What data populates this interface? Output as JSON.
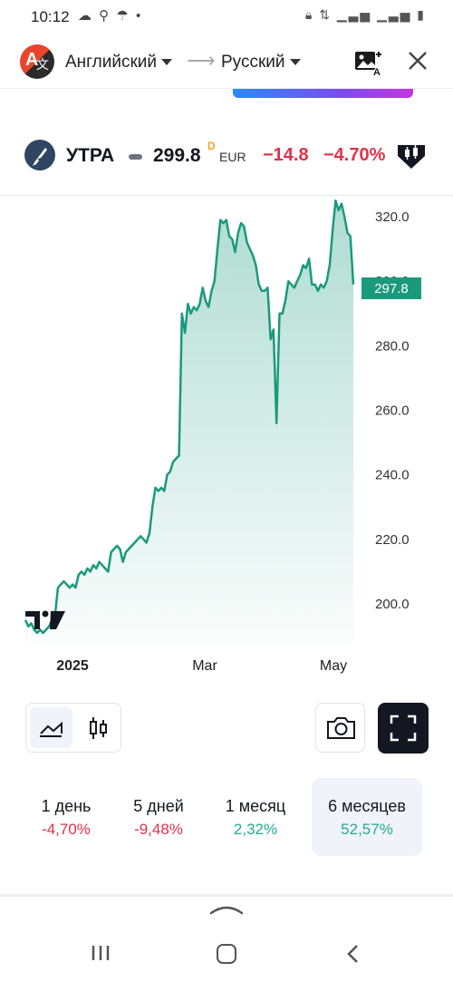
{
  "status_bar": {
    "time": "10:12",
    "left_icons": [
      "cloud-icon",
      "search-icon",
      "umbrella-icon",
      "dot-icon"
    ],
    "right_icons": [
      "lock-icon",
      "data-icon",
      "signal-icon",
      "signal-icon",
      "battery-icon"
    ]
  },
  "translate_bar": {
    "source_language": "Английский",
    "arrow": "⟶",
    "target_language": "Русский"
  },
  "symbol": {
    "name": "УТРА",
    "price": "299.8",
    "delay_flag": "D",
    "currency": "EUR",
    "change": "−14.8",
    "change_percent": "−4.70%"
  },
  "colors": {
    "line": "#1a9a7c",
    "negative": "#e0314b",
    "positive": "#22ab94",
    "price_tag": "#1a9a7c"
  },
  "chart_data": {
    "type": "area",
    "x_ticks": [
      "2025",
      "Mar",
      "May"
    ],
    "y_ticks": [
      "320.0",
      "300.0",
      "280.0",
      "260.0",
      "240.0",
      "220.0",
      "200.0"
    ],
    "ylim": [
      187,
      328
    ],
    "last_value_label": "297.8",
    "values": [
      195,
      193,
      194,
      192,
      191,
      192,
      191,
      192,
      193,
      195,
      196,
      205,
      206,
      207,
      206,
      205,
      206,
      205,
      209,
      210,
      209,
      211,
      210,
      212,
      211,
      213,
      212,
      211,
      210,
      216,
      217,
      218,
      217,
      213,
      216,
      217,
      218,
      219,
      220,
      221,
      220,
      219,
      222,
      230,
      236,
      235,
      236,
      235,
      240,
      241,
      244,
      245,
      246,
      290,
      284,
      293,
      290,
      292,
      291,
      293,
      298,
      294,
      292,
      297,
      300,
      310,
      319,
      318,
      319,
      314,
      313,
      309,
      315,
      318,
      317,
      312,
      310,
      308,
      305,
      299,
      297,
      297,
      298,
      282,
      285,
      256,
      290,
      290,
      294,
      300,
      299,
      298,
      300,
      302,
      305,
      304,
      307,
      299,
      299,
      297,
      299,
      298,
      300,
      305,
      316,
      325,
      322,
      324,
      320,
      315,
      314,
      299
    ]
  },
  "chart_type_buttons": [
    "line-chart-icon",
    "candlestick-icon"
  ],
  "periods": [
    {
      "label": "1 день",
      "change": "-4,70%",
      "direction": "negative"
    },
    {
      "label": "5 дней",
      "change": "-9,48%",
      "direction": "negative"
    },
    {
      "label": "1 месяц",
      "change": "2,32%",
      "direction": "positive"
    },
    {
      "label": "6 месяцев",
      "change": "52,57%",
      "direction": "positive",
      "selected": true
    }
  ]
}
